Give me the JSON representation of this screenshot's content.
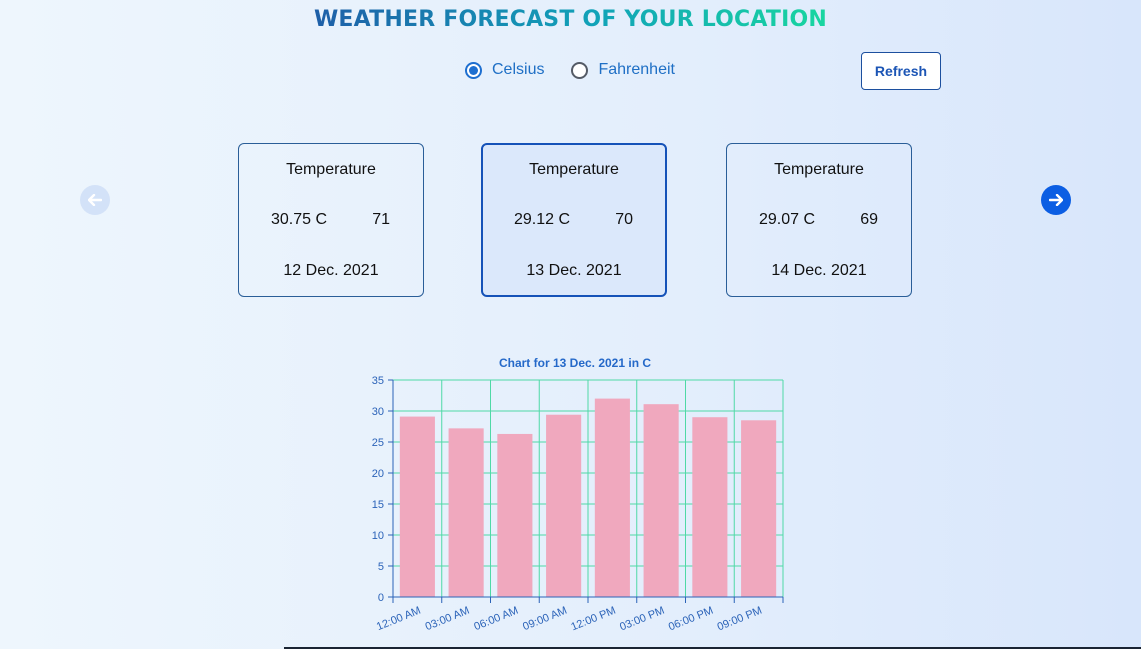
{
  "header": {
    "title": "WEATHER FORECAST OF YOUR LOCATION"
  },
  "units": {
    "options": [
      {
        "label": "Celsius",
        "checked": true
      },
      {
        "label": "Fahrenheit",
        "checked": false
      }
    ]
  },
  "toolbar": {
    "refresh_label": "Refresh"
  },
  "carousel": {
    "prev_icon": "arrow-left-icon",
    "next_icon": "arrow-right-icon",
    "cards": [
      {
        "title": "Temperature",
        "temp": "30.75 C",
        "humidity": "71",
        "date": "12 Dec. 2021",
        "active": false
      },
      {
        "title": "Temperature",
        "temp": "29.12 C",
        "humidity": "70",
        "date": "13 Dec. 2021",
        "active": true
      },
      {
        "title": "Temperature",
        "temp": "29.07 C",
        "humidity": "69",
        "date": "14 Dec. 2021",
        "active": false
      }
    ]
  },
  "colors": {
    "bar": "#f0a8be",
    "grid": "#4fd9a6",
    "axis_text": "#2b63b8",
    "title_text": "#2569c9",
    "accent": "#0b5ee3"
  },
  "chart_data": {
    "type": "bar",
    "title": "Chart for 13 Dec. 2021 in C",
    "categories": [
      "12:00 AM",
      "03:00 AM",
      "06:00 AM",
      "09:00 AM",
      "12:00 PM",
      "03:00 PM",
      "06:00 PM",
      "09:00 PM"
    ],
    "values": [
      29.1,
      27.2,
      26.3,
      29.4,
      32.0,
      31.1,
      29.0,
      28.5
    ],
    "ylim": [
      0,
      35
    ],
    "yticks": [
      0,
      5,
      10,
      15,
      20,
      25,
      30,
      35
    ],
    "grid": true,
    "xlabel": "",
    "ylabel": ""
  }
}
